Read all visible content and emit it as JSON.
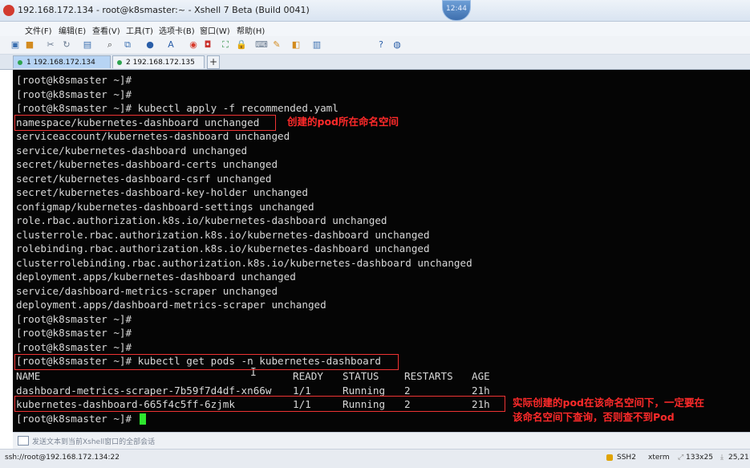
{
  "window": {
    "title": "192.168.172.134 - root@k8smaster:~ - Xshell 7 Beta (Build 0041)",
    "clock": "12:44"
  },
  "menu": [
    "文件(F)",
    "编辑(E)",
    "查看(V)",
    "工具(T)",
    "选项卡(B)",
    "窗口(W)",
    "帮助(H)"
  ],
  "tabs": [
    {
      "label": "1 192.168.172.134",
      "active": true
    },
    {
      "label": "2 192.168.172.135",
      "active": false
    }
  ],
  "terminal": {
    "lines": [
      "[root@k8smaster ~]#",
      "[root@k8smaster ~]#",
      "[root@k8smaster ~]# kubectl apply -f recommended.yaml",
      "namespace/kubernetes-dashboard unchanged",
      "serviceaccount/kubernetes-dashboard unchanged",
      "service/kubernetes-dashboard unchanged",
      "secret/kubernetes-dashboard-certs unchanged",
      "secret/kubernetes-dashboard-csrf unchanged",
      "secret/kubernetes-dashboard-key-holder unchanged",
      "configmap/kubernetes-dashboard-settings unchanged",
      "role.rbac.authorization.k8s.io/kubernetes-dashboard unchanged",
      "clusterrole.rbac.authorization.k8s.io/kubernetes-dashboard unchanged",
      "rolebinding.rbac.authorization.k8s.io/kubernetes-dashboard unchanged",
      "clusterrolebinding.rbac.authorization.k8s.io/kubernetes-dashboard unchanged",
      "deployment.apps/kubernetes-dashboard unchanged",
      "service/dashboard-metrics-scraper unchanged",
      "deployment.apps/dashboard-metrics-scraper unchanged",
      "[root@k8smaster ~]#",
      "[root@k8smaster ~]#",
      "[root@k8smaster ~]#",
      "[root@k8smaster ~]# kubectl get pods -n kubernetes-dashboard"
    ],
    "pods_header": [
      "NAME",
      "READY",
      "STATUS",
      "RESTARTS",
      "AGE"
    ],
    "pods": [
      [
        "dashboard-metrics-scraper-7b59f7d4df-xn66w",
        "1/1",
        "Running",
        "2",
        "21h"
      ],
      [
        "kubernetes-dashboard-665f4c5ff-6zjmk",
        "1/1",
        "Running",
        "2",
        "21h"
      ]
    ],
    "prompt": "[root@k8smaster ~]#",
    "cursor_color": "#2ee62e"
  },
  "annotations": {
    "namespace_note": "创建的pod所在命名空间",
    "pod_note_line1": "实际创建的pod在该命名空间下，一定要在",
    "pod_note_line2": "该命名空间下查询，否则查不到Pod",
    "color": "#ff2a2a"
  },
  "compose_bar": {
    "placeholder": "发送文本到当前Xshell窗口的全部会话"
  },
  "status": {
    "connection": "ssh://root@192.168.172.134:22",
    "protocol": "SSH2",
    "term": "xterm",
    "size": "133x25",
    "position": "25,21"
  }
}
